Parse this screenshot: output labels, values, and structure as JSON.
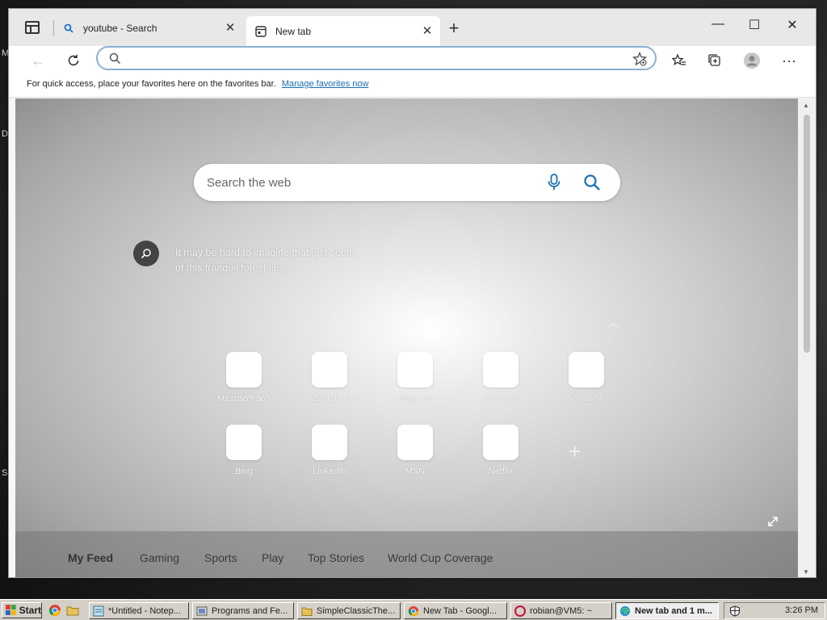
{
  "browser": {
    "tabs": [
      {
        "title": "youtube - Search",
        "active": false
      },
      {
        "title": "New tab",
        "active": true
      }
    ],
    "address": {
      "value": "",
      "placeholder": ""
    },
    "favorites_bar": {
      "message": "For quick access, place your favorites here on the favorites bar.",
      "link": "Manage favorites now"
    }
  },
  "newtab": {
    "search_placeholder": "Search the web",
    "image_info": {
      "line1": "It may be hard to imagine that just south",
      "line2": "of this tranquil forest lies..."
    },
    "quick_links_row1": [
      {
        "label": "Microsoft 365",
        "ad": ""
      },
      {
        "label": "Walmart",
        "ad": "Ad"
      },
      {
        "label": "eBay",
        "ad": "Ad"
      },
      {
        "label": "QVC",
        "ad": "Ad"
      },
      {
        "label": "Wayfair",
        "ad": "Ad"
      }
    ],
    "quick_links_row2": [
      {
        "label": "Bing"
      },
      {
        "label": "LinkedIn"
      },
      {
        "label": "MSN"
      },
      {
        "label": "Netflix"
      }
    ],
    "feed_tabs": [
      "My Feed",
      "Gaming",
      "Sports",
      "Play",
      "Top Stories",
      "World Cup Coverage"
    ]
  },
  "taskbar": {
    "start": "Start",
    "buttons": [
      {
        "label": "*Untitled - Notep..."
      },
      {
        "label": "Programs and Fe..."
      },
      {
        "label": "SimpleClassicThe..."
      },
      {
        "label": "New Tab - Googl..."
      },
      {
        "label": "robian@VM5: ~"
      },
      {
        "label": "New tab and 1 m..."
      }
    ],
    "clock": "3:26 PM"
  },
  "colors": {
    "accent": "#1a6fb3",
    "taskbar": "#d4d0c8"
  }
}
